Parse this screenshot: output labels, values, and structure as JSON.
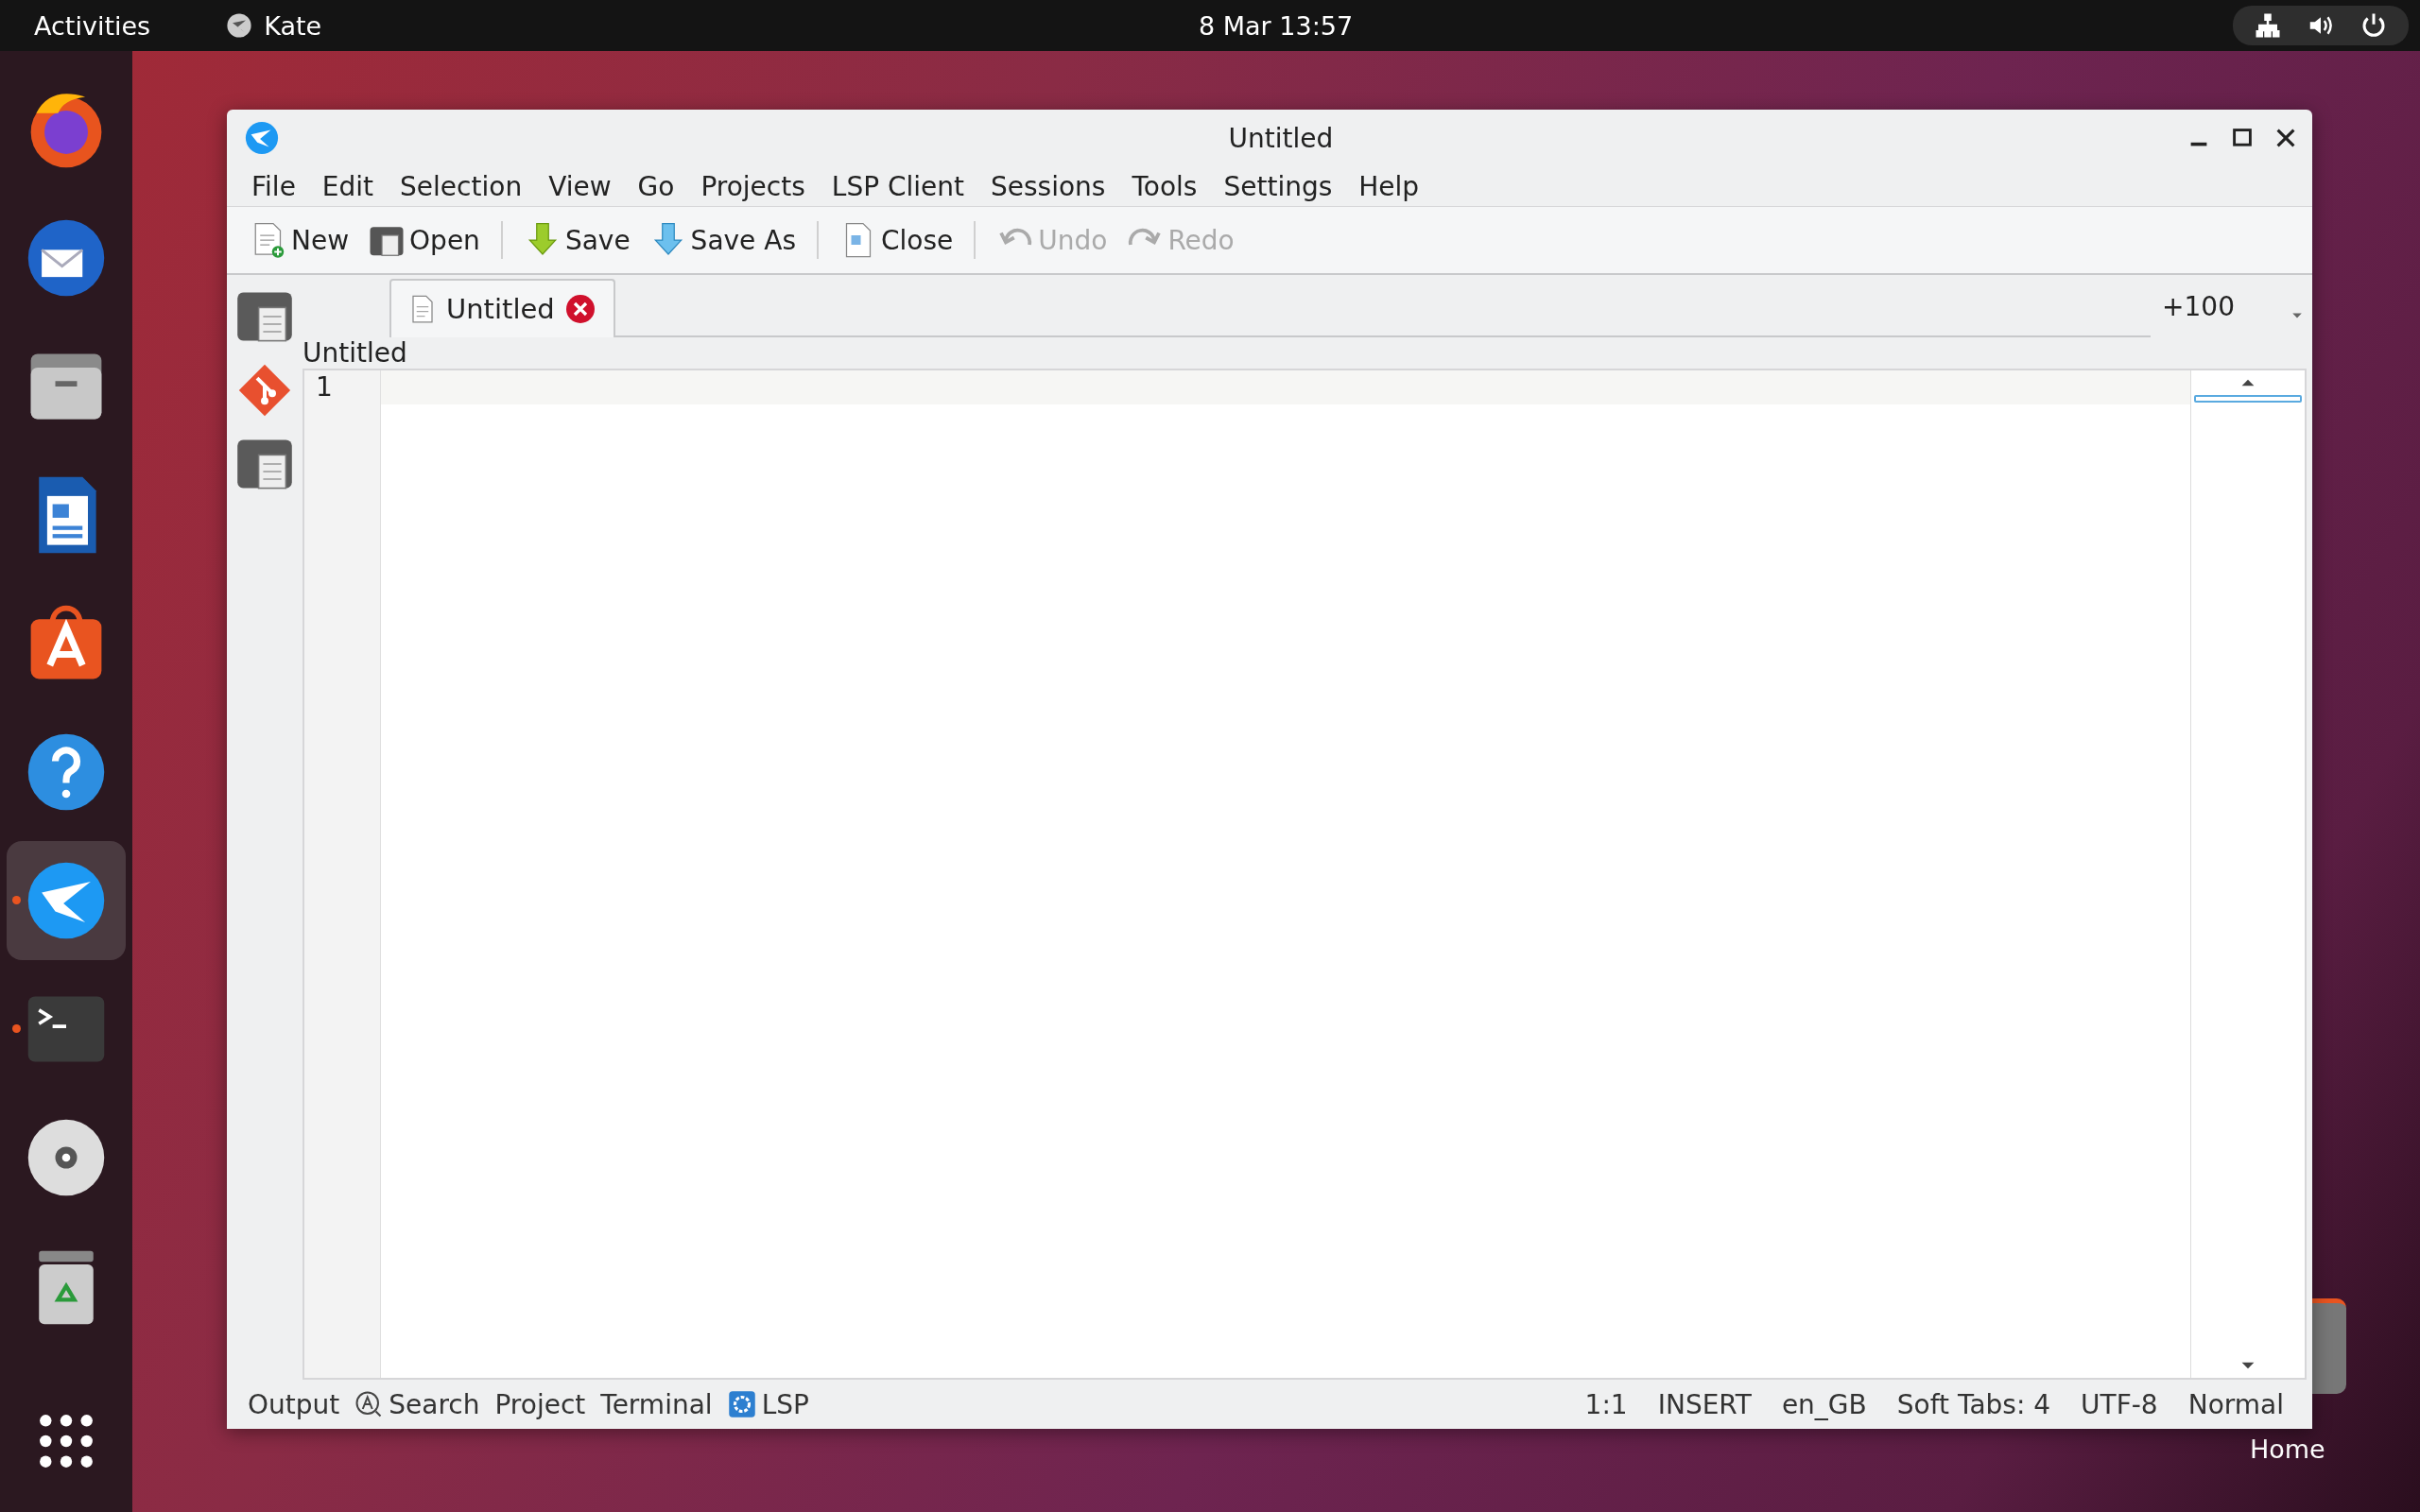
{
  "top_bar": {
    "activities": "Activities",
    "app_name": "Kate",
    "clock": "8 Mar  13:57"
  },
  "dock": {
    "items": [
      {
        "kind": "browser",
        "running": false,
        "selected": false
      },
      {
        "kind": "mail",
        "running": false,
        "selected": false
      },
      {
        "kind": "files",
        "running": false,
        "selected": false
      },
      {
        "kind": "document",
        "running": false,
        "selected": false
      },
      {
        "kind": "store",
        "running": false,
        "selected": false
      },
      {
        "kind": "help",
        "running": false,
        "selected": false
      },
      {
        "kind": "editor",
        "running": true,
        "selected": true
      },
      {
        "kind": "terminal",
        "running": true,
        "selected": false
      },
      {
        "kind": "disc",
        "running": false,
        "selected": false
      },
      {
        "kind": "trash",
        "running": false,
        "selected": false
      }
    ]
  },
  "desktop_icon": {
    "label": "Home"
  },
  "window": {
    "title": "Untitled",
    "menu": [
      "File",
      "Edit",
      "Selection",
      "View",
      "Go",
      "Projects",
      "LSP Client",
      "Sessions",
      "Tools",
      "Settings",
      "Help"
    ],
    "toolbar": [
      {
        "kind": "new",
        "label": "New",
        "disabled": false
      },
      {
        "kind": "open",
        "label": "Open",
        "disabled": false
      },
      {
        "kind": "save",
        "label": "Save",
        "disabled": false
      },
      {
        "kind": "saveas",
        "label": "Save As",
        "disabled": false
      },
      {
        "kind": "close",
        "label": "Close",
        "disabled": false
      },
      {
        "kind": "undo",
        "label": "Undo",
        "disabled": true
      },
      {
        "kind": "redo",
        "label": "Redo",
        "disabled": true
      }
    ],
    "side_tools": [
      {
        "kind": "documents"
      },
      {
        "kind": "git"
      },
      {
        "kind": "projects"
      }
    ],
    "tabs": [
      {
        "label": "Untitled",
        "selected": true
      }
    ],
    "tab_counter": "+100",
    "breadcrumb": "Untitled",
    "editor": {
      "line_numbers": [
        "1"
      ]
    },
    "bottom_tools": [
      {
        "kind": "plain",
        "label": "Output"
      },
      {
        "kind": "search",
        "label": "Search"
      },
      {
        "kind": "plain",
        "label": "Project"
      },
      {
        "kind": "plain",
        "label": "Terminal"
      },
      {
        "kind": "lsp",
        "label": "LSP"
      }
    ],
    "status_bar": [
      "1:1",
      "INSERT",
      "en_GB",
      "Soft Tabs: 4",
      "UTF-8",
      "Normal"
    ]
  }
}
